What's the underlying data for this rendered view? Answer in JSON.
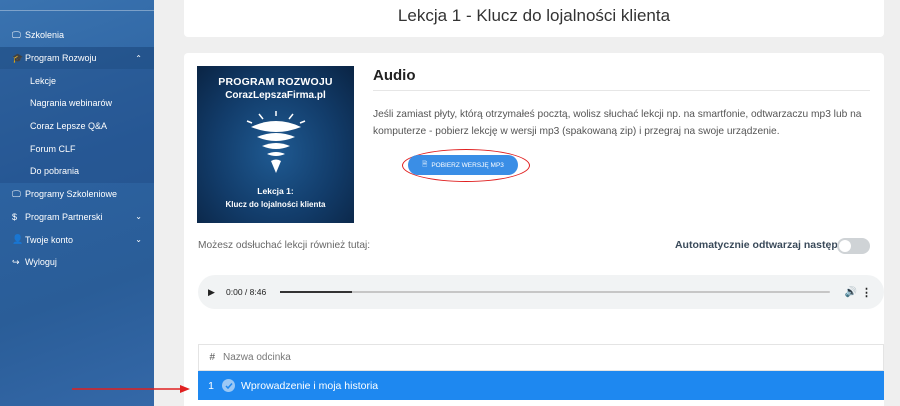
{
  "sidebar": {
    "items": [
      {
        "label": "Szkolenia",
        "icon": "laptop-icon"
      },
      {
        "label": "Program Rozwoju",
        "icon": "graduation-cap-icon"
      },
      {
        "label": "Lekcje"
      },
      {
        "label": "Nagrania webinarów"
      },
      {
        "label": "Coraz Lepsze Q&A"
      },
      {
        "label": "Forum CLF"
      },
      {
        "label": "Do pobrania"
      },
      {
        "label": "Programy Szkoleniowe",
        "icon": "laptop-icon"
      },
      {
        "label": "Program Partnerski",
        "icon": "dollar-icon",
        "prefix": "$"
      },
      {
        "label": "Twoje konto",
        "icon": "user-icon"
      },
      {
        "label": "Wyloguj",
        "icon": "sign-out-icon"
      }
    ]
  },
  "page": {
    "title": "Lekcja 1 - Klucz do lojalności klienta"
  },
  "cover": {
    "line1": "PROGRAM ROZWOJU",
    "line2": "CorazLepszaFirma.pl",
    "line3": "Lekcja 1:",
    "line4": "Klucz do lojalności klienta"
  },
  "audio": {
    "heading": "Audio",
    "description": "Jeśli zamiast płyty, którą otrzymałeś pocztą, wolisz słuchać lekcji np. na smartfonie, odtwarzaczu mp3 lub na komputerze - pobierz lekcję w wersji mp3 (spakowaną zip) i przegraj na swoje urządzenie.",
    "download_label": "POBIERZ WERSJĘ MP3",
    "listen_text": "Możesz odsłuchać lekcji również tutaj:",
    "autoplay_label": "Automatycznie odtwarzaj następny",
    "player_time": "0:00 / 8:46",
    "progress": 0.13
  },
  "episodes": {
    "header_num": "#",
    "header_name": "Nazwa odcinka",
    "rows": [
      {
        "num": "1",
        "title": "Wprowadzenie i moja historia"
      }
    ]
  },
  "colors": {
    "sidebar": "#2c62a0",
    "accent": "#1e88f0",
    "annotation": "#e02020"
  }
}
